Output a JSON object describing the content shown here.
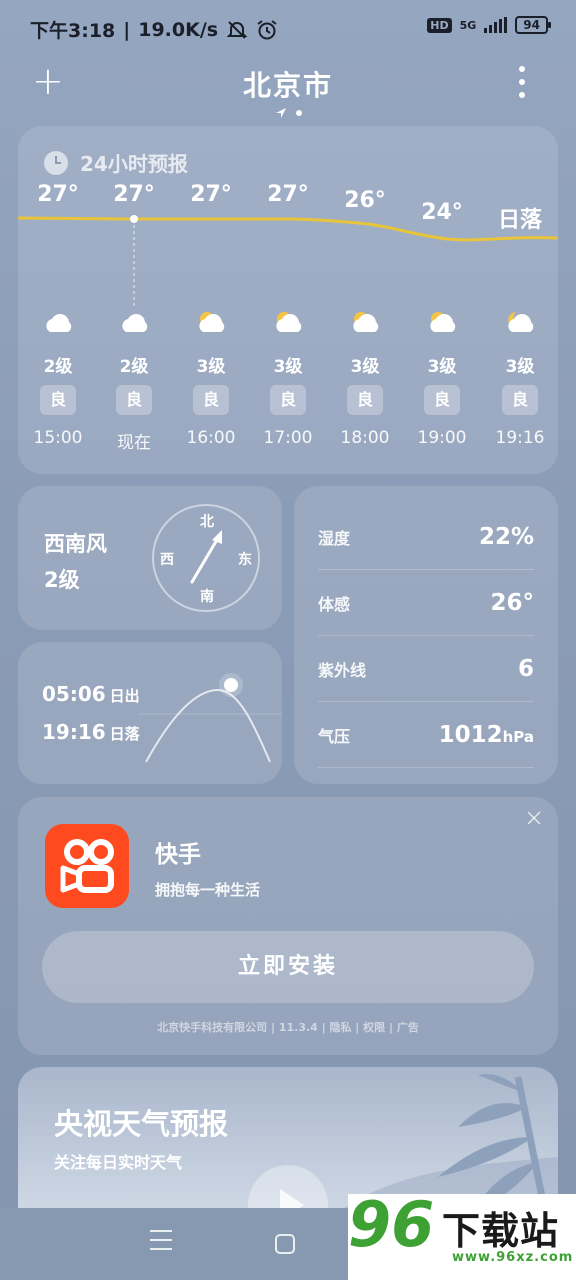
{
  "status_bar": {
    "time": "下午3:18",
    "speed": "19.0K/s",
    "network": "5G",
    "hd": "HD",
    "battery": "94"
  },
  "header": {
    "add_icon": "plus-icon",
    "city": "北京市",
    "more_icon": "more-vert-icon"
  },
  "forecast_24h": {
    "title": "24小时预报",
    "hours": [
      {
        "temp": "27°",
        "icon": "cloud-icon",
        "wind": "2级",
        "aqi": "良",
        "time": "15:00"
      },
      {
        "temp": "27°",
        "icon": "cloud-icon",
        "wind": "2级",
        "aqi": "良",
        "time": "现在"
      },
      {
        "temp": "27°",
        "icon": "partly-cloudy-icon",
        "wind": "3级",
        "aqi": "良",
        "time": "16:00"
      },
      {
        "temp": "27°",
        "icon": "partly-cloudy-icon",
        "wind": "3级",
        "aqi": "良",
        "time": "17:00"
      },
      {
        "temp": "26°",
        "icon": "partly-cloudy-icon",
        "wind": "3级",
        "aqi": "良",
        "time": "18:00"
      },
      {
        "temp": "24°",
        "icon": "partly-cloudy-icon",
        "wind": "3级",
        "aqi": "良",
        "time": "19:00"
      },
      {
        "temp": "日落",
        "icon": "moon-cloud-icon",
        "wind": "3级",
        "aqi": "良",
        "time": "19:16"
      }
    ]
  },
  "wind": {
    "direction": "西南风",
    "level": "2级",
    "compass": {
      "n": "北",
      "s": "南",
      "e": "东",
      "w": "西"
    }
  },
  "sun": {
    "sunrise_time": "05:06",
    "sunrise_label": "日出",
    "sunset_time": "19:16",
    "sunset_label": "日落"
  },
  "details": [
    {
      "label": "湿度",
      "value": "22%",
      "unit": ""
    },
    {
      "label": "体感",
      "value": "26°",
      "unit": ""
    },
    {
      "label": "紫外线",
      "value": "6",
      "unit": ""
    },
    {
      "label": "气压",
      "value": "1012",
      "unit": "hPa"
    }
  ],
  "ad": {
    "close": "×",
    "app_name": "快手",
    "slogan": "拥抱每一种生活",
    "install_label": "立即安装",
    "footer": "北京快手科技有限公司 | 11.3.4 | 隐私 | 权限 | 广告",
    "brand_color": "#fe4a1e"
  },
  "cctv": {
    "title": "央视天气预报",
    "subtitle": "关注每日实时天气"
  },
  "watermark": {
    "big": "96",
    "text": "下载站",
    "url": "www.96xz.com"
  }
}
